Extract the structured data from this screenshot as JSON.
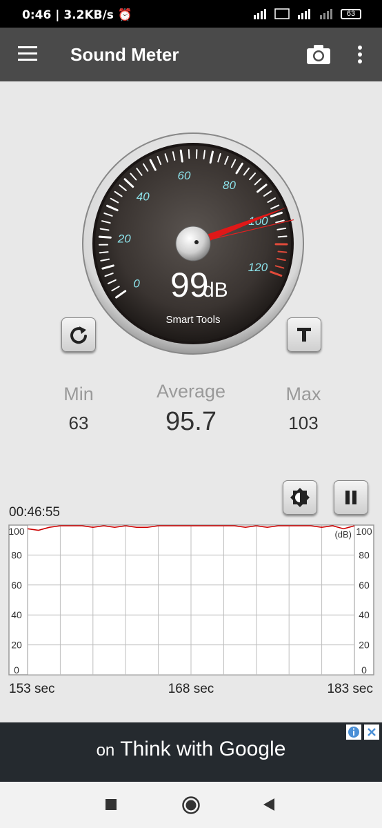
{
  "status": {
    "time": "0:46",
    "speed": "3.2KB/s",
    "battery": "63"
  },
  "appbar": {
    "title": "Sound Meter"
  },
  "gauge": {
    "value": 99,
    "reading": "99",
    "unit": "dB",
    "brand": "Smart Tools",
    "scale_labels": [
      "0",
      "20",
      "40",
      "60",
      "80",
      "100",
      "120"
    ],
    "scale_values": [
      0,
      20,
      40,
      60,
      80,
      100,
      120
    ],
    "max_value": 103
  },
  "stats": {
    "min_label": "Min",
    "min_value": "63",
    "avg_label": "Average",
    "avg_value": "95.7",
    "max_label": "Max",
    "max_value": "103"
  },
  "graph": {
    "timestamp": "00:46:55",
    "unit_label": "(dB)",
    "y_labels": [
      "100",
      "80",
      "60",
      "40",
      "20",
      "0"
    ],
    "x_labels": [
      "153 sec",
      "168 sec",
      "183 sec"
    ],
    "line_color": "#cc0000"
  },
  "chart_data": {
    "type": "line",
    "x": [
      153,
      154,
      155,
      156,
      157,
      158,
      159,
      160,
      161,
      162,
      163,
      164,
      165,
      166,
      167,
      168,
      169,
      170,
      171,
      172,
      173,
      174,
      175,
      176,
      177,
      178,
      179,
      180,
      181,
      182,
      183
    ],
    "series": [
      {
        "values": [
          98,
          97,
          99,
          100,
          100,
          100,
          99,
          100,
          99,
          100,
          99,
          99,
          100,
          100,
          100,
          100,
          100,
          100,
          100,
          100,
          99,
          100,
          99,
          100,
          100,
          100,
          100,
          99,
          100,
          98,
          100
        ]
      }
    ],
    "ylim": [
      0,
      100
    ]
  },
  "ad": {
    "pre": "on",
    "text": "Think with Google"
  },
  "colors": {
    "appbar": "#4a4a4a",
    "accent": "#cc0000",
    "dial_text": "#8de4ec"
  }
}
